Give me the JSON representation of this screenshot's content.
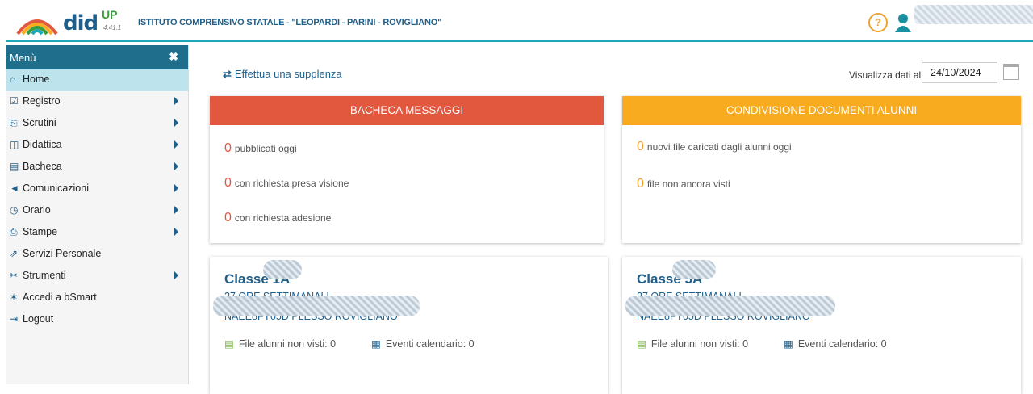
{
  "header": {
    "brand": "did",
    "brand_sup": "UP",
    "version": "4.41.1",
    "school": "ISTITUTO COMPRENSIVO STATALE - \"LEOPARDI - PARINI - ROVIGLIANO\"",
    "help": "?"
  },
  "sidebar": {
    "title": "Menù",
    "close": "✖",
    "items": [
      {
        "label": "Home",
        "icon": "home-icon",
        "glyph": "⌂",
        "active": true,
        "submenu": false
      },
      {
        "label": "Registro",
        "icon": "calendar-check-icon",
        "glyph": "☑",
        "submenu": true
      },
      {
        "label": "Scrutini",
        "icon": "document-icon",
        "glyph": "⎘",
        "submenu": true
      },
      {
        "label": "Didattica",
        "icon": "book-icon",
        "glyph": "◫",
        "submenu": true
      },
      {
        "label": "Bacheca",
        "icon": "newspaper-icon",
        "glyph": "▤",
        "submenu": true
      },
      {
        "label": "Comunicazioni",
        "icon": "megaphone-icon",
        "glyph": "◄",
        "submenu": true
      },
      {
        "label": "Orario",
        "icon": "clock-icon",
        "glyph": "◷",
        "submenu": true
      },
      {
        "label": "Stampe",
        "icon": "printer-icon",
        "glyph": "⎙",
        "submenu": true
      },
      {
        "label": "Servizi Personale",
        "icon": "share-icon",
        "glyph": "⇗",
        "submenu": false
      },
      {
        "label": "Strumenti",
        "icon": "tools-icon",
        "glyph": "✂",
        "submenu": true
      },
      {
        "label": "Accedi a bSmart",
        "icon": "star-icon",
        "glyph": "✶",
        "submenu": false
      },
      {
        "label": "Logout",
        "icon": "logout-icon",
        "glyph": "⇥",
        "submenu": false
      }
    ]
  },
  "main": {
    "supplenza": "Effettua una supplenza",
    "date_label": "Visualizza dati al:",
    "date_value": "24/10/2024"
  },
  "bacheca": {
    "title": "BACHECA MESSAGGI",
    "color": "#e2583e",
    "stats": [
      {
        "num": "0",
        "label": "pubblicati oggi"
      },
      {
        "num": "0",
        "label": "con richiesta presa visione"
      },
      {
        "num": "0",
        "label": "con richiesta adesione"
      }
    ]
  },
  "condivisione": {
    "title": "CONDIVISIONE DOCUMENTI ALUNNI",
    "color": "#f9ab1f",
    "stats": [
      {
        "num": "0",
        "label": "nuovi file caricati dagli alunni oggi"
      },
      {
        "num": "0",
        "label": "file non ancora visti"
      }
    ]
  },
  "classes": [
    {
      "title": "Classe 1A",
      "ore": "27 ORE SETTIMANALI",
      "plesso": "NAEE8FY05D PLESSO ROVIGLIANO",
      "files": "File alunni non visti: 0",
      "eventi": "Eventi calendario: 0"
    },
    {
      "title": "Classe 5A",
      "ore": "27 ORE SETTIMANALI",
      "plesso": "NAEE8FY05D PLESSO ROVIGLIANO",
      "files": "File alunni non visti: 0",
      "eventi": "Eventi calendario: 0"
    }
  ]
}
